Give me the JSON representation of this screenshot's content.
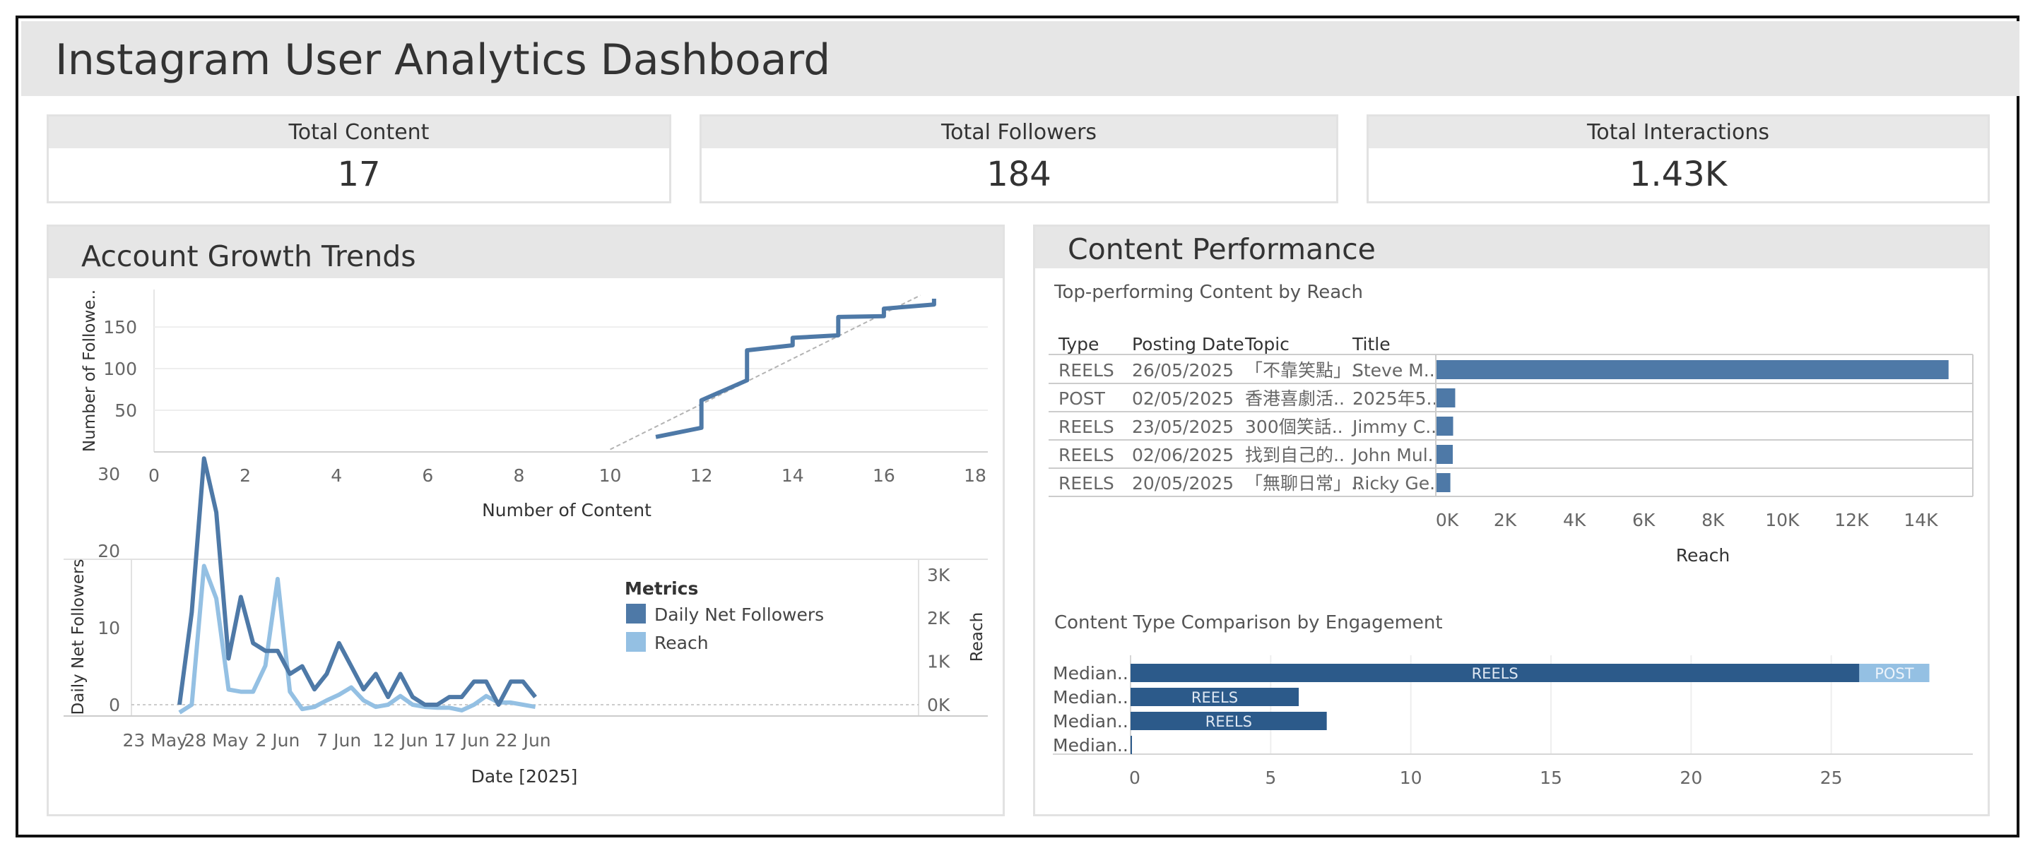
{
  "dashboard_title": "Instagram User Analytics Dashboard",
  "kpis": [
    {
      "label": "Total Content",
      "value": "17"
    },
    {
      "label": "Total Followers",
      "value": "184"
    },
    {
      "label": "Total Interactions",
      "value": "1.43K"
    }
  ],
  "panels": {
    "growth_title": "Account Growth Trends",
    "performance_title": "Content Performance"
  },
  "colors": {
    "dark_blue": "#4e79a7",
    "light_blue": "#94c0e3",
    "navy": "#2c5a8a"
  },
  "chart_data": [
    {
      "type": "line",
      "title": "",
      "xlabel": "Number of Content",
      "ylabel": "Number of Followe..",
      "xlim": [
        0,
        18
      ],
      "xticks": [
        "0",
        "2",
        "4",
        "6",
        "8",
        "10",
        "12",
        "14",
        "16",
        "18"
      ],
      "ylim": [
        0,
        195
      ],
      "yticks": [
        "50",
        "100",
        "150"
      ],
      "series": [
        {
          "points": [
            [
              11,
              18
            ],
            [
              12,
              29
            ],
            [
              12,
              62
            ],
            [
              13,
              86
            ],
            [
              13,
              122
            ],
            [
              14,
              128
            ],
            [
              14,
              137
            ],
            [
              15,
              140
            ],
            [
              15,
              162
            ],
            [
              16,
              163
            ],
            [
              16,
              172
            ],
            [
              17.1,
              177
            ],
            [
              17.1,
              184
            ]
          ]
        }
      ],
      "trendline": [
        [
          10,
          3
        ],
        [
          16.8,
          188
        ]
      ]
    },
    {
      "type": "line",
      "title": "",
      "xlabel": "Date [2025]",
      "ylabel": "Daily Net Followers",
      "y2label": "Reach",
      "x": [
        "25 May",
        "26 May",
        "27 May",
        "28 May",
        "29 May",
        "30 May",
        "31 May",
        "1 Jun",
        "2 Jun",
        "3 Jun",
        "4 Jun",
        "5 Jun",
        "6 Jun",
        "7 Jun",
        "8 Jun",
        "9 Jun",
        "10 Jun",
        "11 Jun",
        "12 Jun",
        "13 Jun",
        "14 Jun",
        "15 Jun",
        "16 Jun",
        "17 Jun",
        "18 Jun",
        "19 Jun",
        "20 Jun",
        "21 Jun",
        "22 Jun",
        "23 Jun"
      ],
      "xticks": [
        "23 May",
        "28 May",
        "2 Jun",
        "7 Jun",
        "12 Jun",
        "17 Jun",
        "22 Jun"
      ],
      "ylim": [
        -3,
        36
      ],
      "yticks": [
        "0",
        "10",
        "20",
        "30"
      ],
      "y2ticks": [
        "0K",
        "1K",
        "2K",
        "3K"
      ],
      "legend_title": "Metrics",
      "legend_position": "top-right",
      "series": [
        {
          "name": "Daily Net Followers",
          "axis": "left",
          "values": [
            0,
            12,
            32,
            25,
            6,
            14,
            8,
            7,
            7,
            4,
            5,
            2,
            4,
            8,
            5,
            2,
            4,
            1,
            4,
            1,
            0,
            0,
            1,
            1,
            3,
            3,
            0,
            3,
            3,
            1
          ]
        },
        {
          "name": "Reach",
          "axis": "right",
          "values": [
            -180,
            0,
            3200,
            2450,
            350,
            300,
            300,
            900,
            2900,
            300,
            -100,
            -50,
            100,
            230,
            400,
            100,
            -50,
            0,
            200,
            0,
            -50,
            -70,
            -70,
            -130,
            0,
            200,
            50,
            50,
            0,
            -50
          ]
        }
      ]
    },
    {
      "type": "bar",
      "title": "Top-performing Content by Reach",
      "columns": [
        "Type",
        "Posting Date",
        "Topic",
        "Title"
      ],
      "rows": [
        {
          "type": "REELS",
          "date": "26/05/2025",
          "topic": "「不靠笑點」..",
          "title": "Steve M..",
          "reach": 14800
        },
        {
          "type": "POST",
          "date": "02/05/2025",
          "topic": "香港喜劇活..",
          "title": "2025年5..",
          "reach": 560
        },
        {
          "type": "REELS",
          "date": "23/05/2025",
          "topic": "300個笑話..",
          "title": "Jimmy C..",
          "reach": 500
        },
        {
          "type": "REELS",
          "date": "02/06/2025",
          "topic": "找到自己的..",
          "title": "John Mul..",
          "reach": 490
        },
        {
          "type": "REELS",
          "date": "20/05/2025",
          "topic": "「無聊日常」..",
          "title": "Ricky Ge..",
          "reach": 420
        }
      ],
      "xlabel": "Reach",
      "xlim": [
        0,
        15500
      ],
      "xticks": [
        "0K",
        "2K",
        "4K",
        "6K",
        "8K",
        "10K",
        "12K",
        "14K"
      ]
    },
    {
      "type": "bar",
      "title": "Content Type Comparison by Engagement",
      "categories": [
        "Median..",
        "Median..",
        "Median..",
        "Median.."
      ],
      "series": [
        {
          "name": "REELS",
          "values": [
            26,
            6,
            7,
            0.05
          ]
        },
        {
          "name": "POST",
          "values": [
            2.5,
            0,
            0,
            0
          ]
        }
      ],
      "xlim": [
        0,
        30
      ],
      "xticks": [
        "0",
        "5",
        "10",
        "15",
        "20",
        "25"
      ]
    }
  ]
}
